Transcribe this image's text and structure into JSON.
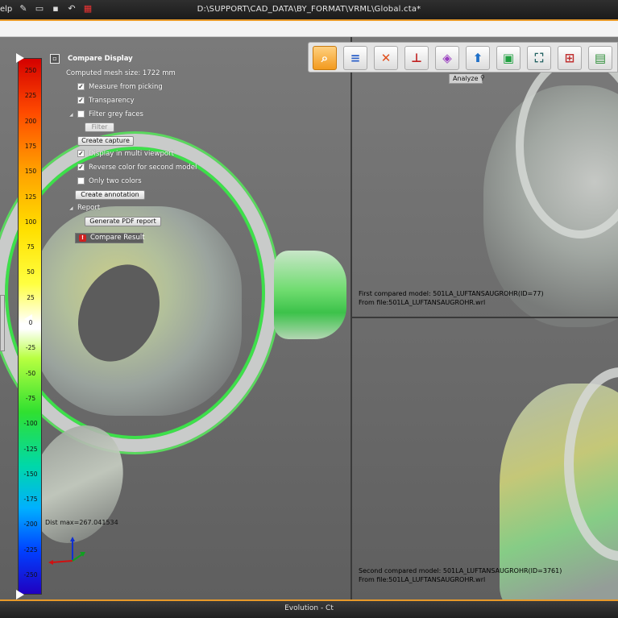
{
  "titlebar": {
    "menu_help": "elp",
    "path": "D:\\SUPPORT\\CAD_DATA\\BY_FORMAT\\VRML\\Global.cta*"
  },
  "scale": {
    "ticks": [
      "250",
      "225",
      "200",
      "175",
      "150",
      "125",
      "100",
      "75",
      "50",
      "25",
      "0",
      "-25",
      "-50",
      "-75",
      "-100",
      "-125",
      "-150",
      "-175",
      "-200",
      "-225",
      "-250"
    ]
  },
  "panel": {
    "title": "Compare Display",
    "mesh_size": "Computed mesh size: 1722 mm",
    "measure_from_picking": "Measure from picking",
    "transparency": "Transparency",
    "filter_grey_faces": "Filter grey faces",
    "filter_button": "Filter",
    "create_capture": "Create capture",
    "display_multi_viewport": "Display in multi viewport",
    "reverse_color": "Reverse color for second model",
    "only_two_colors": "Only two colors",
    "create_annotation": "Create annotation",
    "report": "Report",
    "generate_pdf": "Generate PDF report",
    "compare_result": "Compare Result",
    "checks": {
      "measure_from_picking": true,
      "transparency": true,
      "filter_grey_faces": false,
      "display_multi_viewport": true,
      "reverse_color": true,
      "only_two_colors": false
    }
  },
  "toolbar": {
    "tab_label": "Analyze",
    "buttons": [
      "analyze-magnifier",
      "annotation-pencil",
      "tools-cross",
      "measure",
      "transform-cube",
      "export-upload",
      "frame-select",
      "fit-all",
      "section-view",
      "toolbox"
    ]
  },
  "viewports": {
    "first_model": "First compared model: 501LA_LUFTANSAUGROHR(ID=77)",
    "first_file": "From file:501LA_LUFTANSAUGROHR.wrl",
    "second_model": "Second compared model: 501LA_LUFTANSAUGROHR(ID=3761)",
    "second_file": "From file:501LA_LUFTANSAUGROHR.wrl",
    "dist_max": "Dist max=267.041534"
  },
  "status": {
    "app_title": "Evolution - Ct"
  },
  "colors": {
    "accent": "#e89a2a",
    "active_tool": "#f29a1e"
  }
}
